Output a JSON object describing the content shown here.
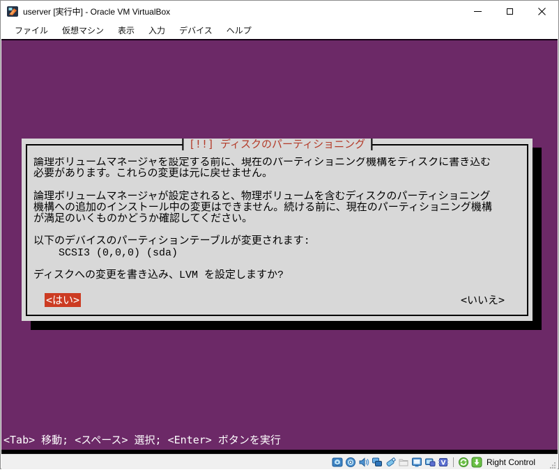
{
  "window": {
    "title": "userver [実行中] - Oracle VM VirtualBox"
  },
  "menubar": {
    "items": [
      "ファイル",
      "仮想マシン",
      "表示",
      "入力",
      "デバイス",
      "ヘルプ"
    ]
  },
  "installer": {
    "dialog": {
      "title": "[!!] ディスクのパーティショニング",
      "body_lines": [
        "論理ボリュームマネージャを設定する前に、現在のパーティショニング機構をディスクに書き込む",
        "必要があります。これらの変更は元に戻せません。",
        "",
        "論理ボリュームマネージャが設定されると、物理ボリュームを含むディスクのパーティショニング",
        "機構への追加のインストール中の変更はできません。続ける前に、現在のパーティショニング機構",
        "が満足のいくものかどうか確認してください。",
        "",
        "以下のデバイスのパーティションテーブルが変更されます:",
        "    SCSI3 (0,0,0) (sda)",
        "",
        "ディスクへの変更を書き込み、LVM を設定しますか?"
      ],
      "buttons": {
        "yes": "<はい>",
        "no": "<いいえ>"
      }
    },
    "help_line": "<Tab> 移動; <スペース> 選択; <Enter> ボタンを実行"
  },
  "statusbar": {
    "host_key": "Right Control",
    "icons": [
      "hard-disk",
      "optical-disc",
      "audio",
      "network",
      "usb",
      "shared-folders",
      "display",
      "recording",
      "features",
      "mouse-integration",
      "keyboard-capture"
    ]
  },
  "colors": {
    "installer_background": "#6c2967",
    "dialog_background": "#d8d8d8",
    "dialog_title_red": "#b33a28",
    "selected_button_red": "#cc3b22"
  }
}
